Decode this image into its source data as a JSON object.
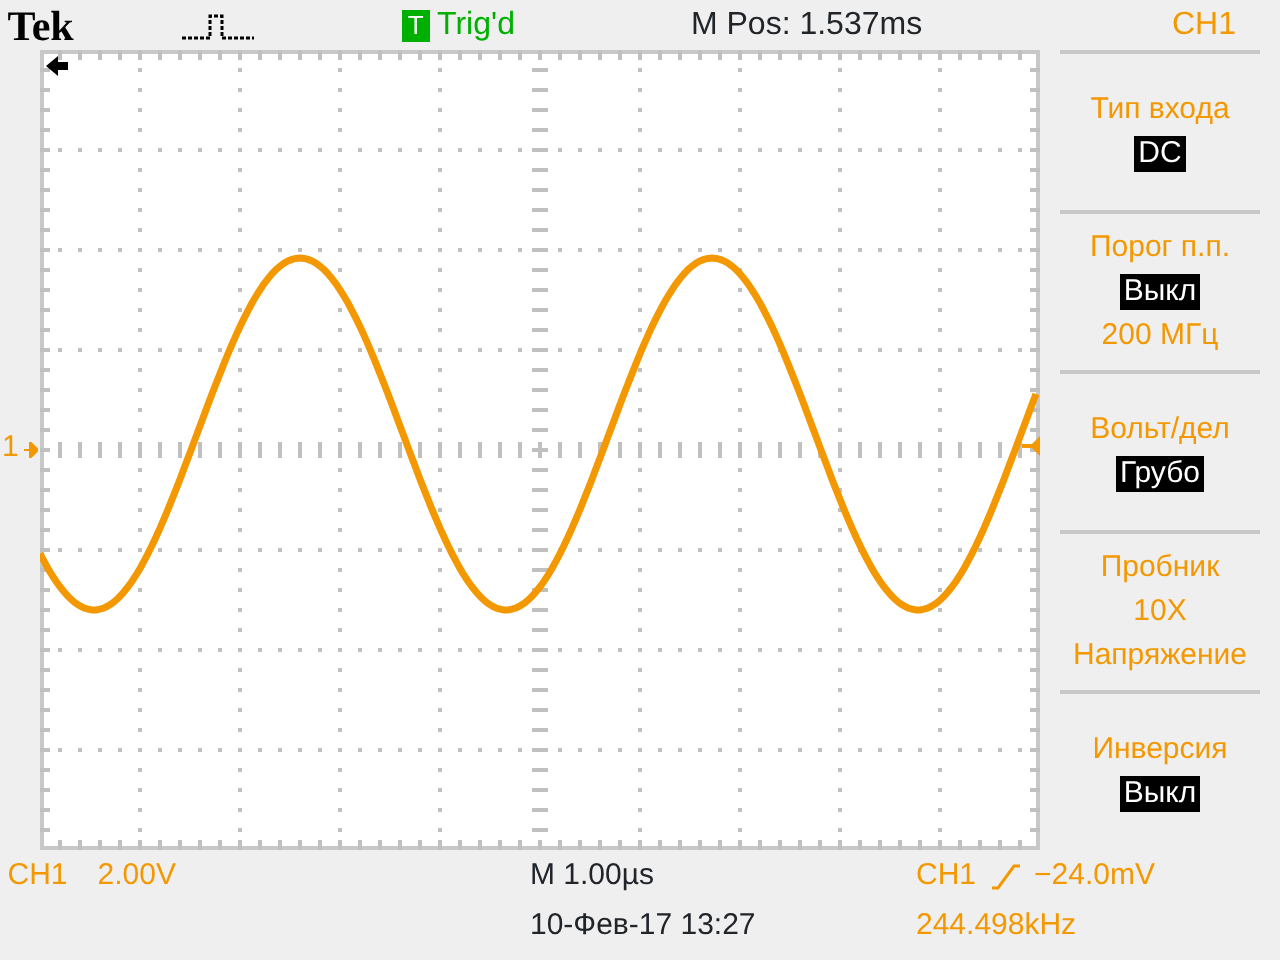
{
  "header": {
    "logo": "Tek",
    "trigger_badge": "T",
    "trigger_status": "Trig'd",
    "position": "M Pos: 1.537ms",
    "channel": "CH1"
  },
  "channel_marker": "1",
  "menu": [
    {
      "title": "Тип входа",
      "values": [
        {
          "text": "DC",
          "kind": "boxed"
        }
      ]
    },
    {
      "title": "Порог п.п.",
      "values": [
        {
          "text": "Выкл",
          "kind": "boxed"
        },
        {
          "text": "200 МГц",
          "kind": "plain"
        }
      ]
    },
    {
      "title": "Вольт/дел",
      "values": [
        {
          "text": "Грубо",
          "kind": "boxed"
        }
      ]
    },
    {
      "title": "Пробник",
      "values": [
        {
          "text": "10X",
          "kind": "plain"
        },
        {
          "text": "Напряжение",
          "kind": "plain"
        }
      ]
    },
    {
      "title": "Инверсия",
      "values": [
        {
          "text": "Выкл",
          "kind": "boxed"
        }
      ]
    }
  ],
  "footer": {
    "channel": "CH1",
    "scale": "2.00V",
    "timebase": "M 1.00µs",
    "date": "10-Фев-17 13:27",
    "trigger_source": "CH1",
    "trigger_level": "−24.0mV",
    "frequency": "244.498kHz"
  }
}
